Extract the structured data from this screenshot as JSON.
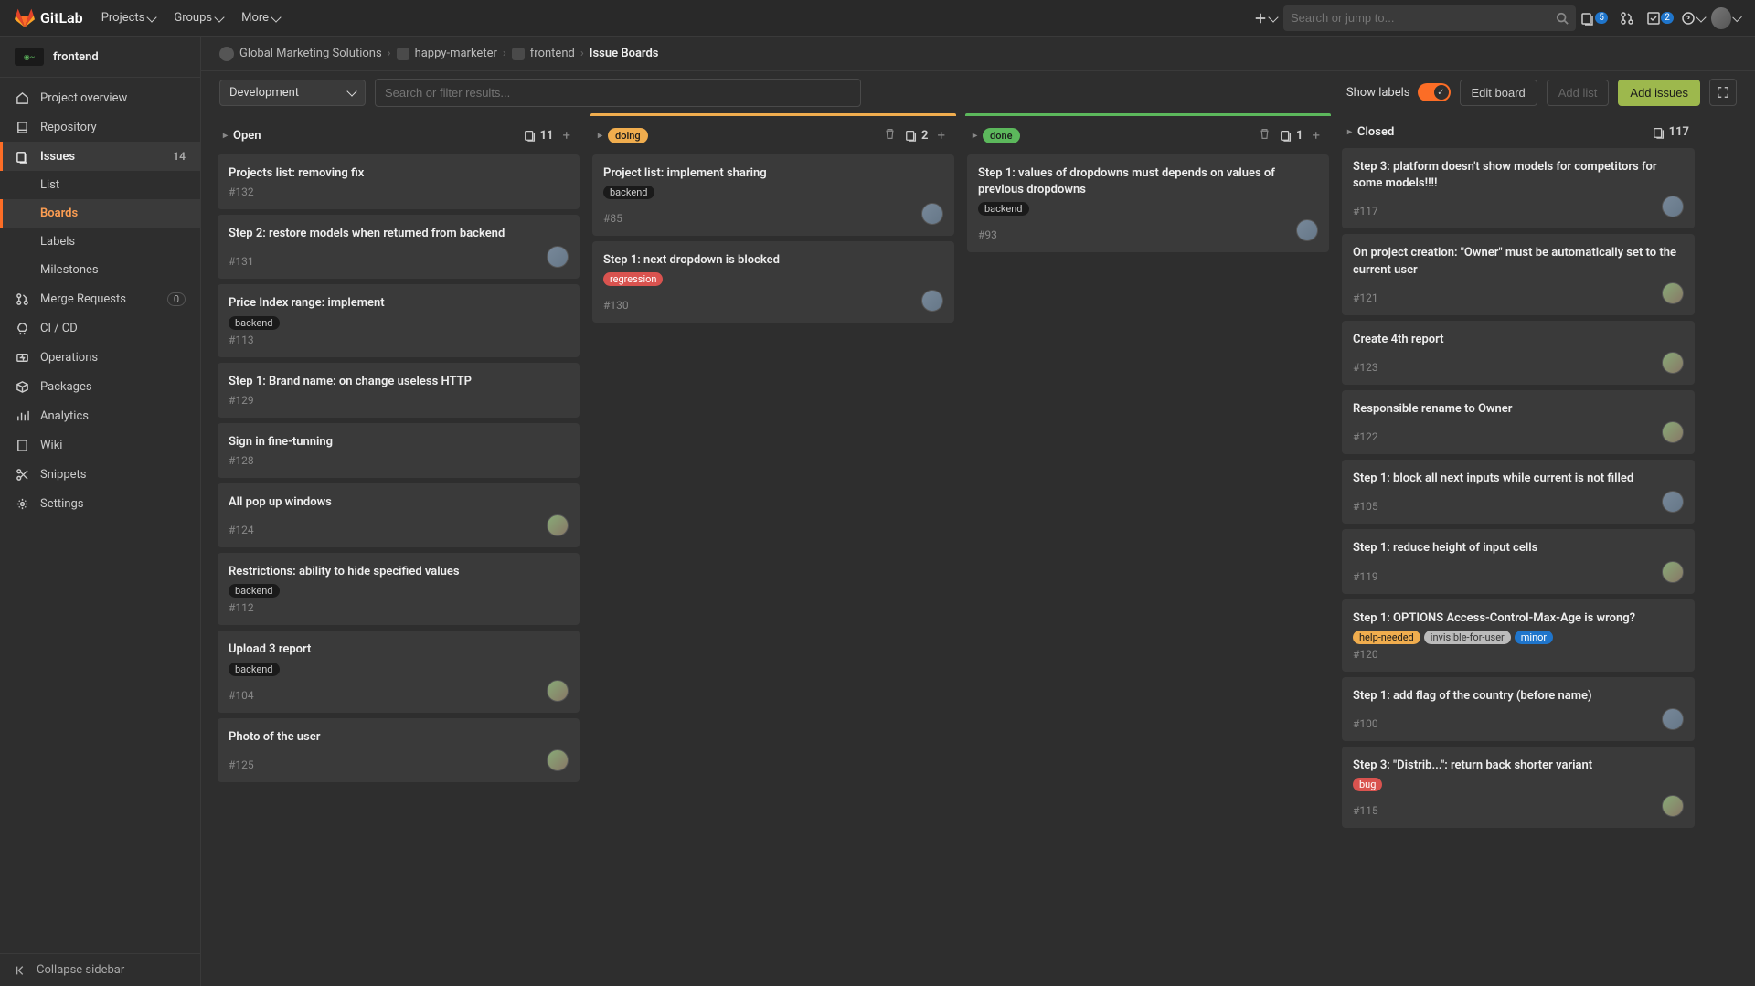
{
  "header": {
    "brand": "GitLab",
    "nav": {
      "projects": "Projects",
      "groups": "Groups",
      "more": "More"
    },
    "search_placeholder": "Search or jump to...",
    "issues_badge": "5",
    "todos_badge": "2"
  },
  "sidebar": {
    "project": "frontend",
    "items": {
      "overview": "Project overview",
      "repository": "Repository",
      "issues": "Issues",
      "issues_count": "14",
      "list": "List",
      "boards": "Boards",
      "labels": "Labels",
      "milestones": "Milestones",
      "merge_requests": "Merge Requests",
      "mr_count": "0",
      "cicd": "CI / CD",
      "operations": "Operations",
      "packages": "Packages",
      "analytics": "Analytics",
      "wiki": "Wiki",
      "snippets": "Snippets",
      "settings": "Settings"
    },
    "collapse": "Collapse sidebar"
  },
  "breadcrumbs": {
    "group": "Global Marketing Solutions",
    "subgroup": "happy-marketer",
    "project": "frontend",
    "page": "Issue Boards"
  },
  "toolbar": {
    "board_name": "Development",
    "filter_placeholder": "Search or filter results...",
    "show_labels": "Show labels",
    "edit_board": "Edit board",
    "add_list": "Add list",
    "add_issues": "Add issues"
  },
  "columns": [
    {
      "key": "open",
      "title": "Open",
      "count": "11",
      "accent": null,
      "label_bg": null,
      "delete": false,
      "cards": [
        {
          "title": "Projects list: removing fix",
          "id": "#132",
          "labels": [],
          "assignee": null
        },
        {
          "title": "Step 2: restore models when returned from backend",
          "id": "#131",
          "labels": [],
          "assignee": "alt"
        },
        {
          "title": "Price Index range: implement",
          "id": "#113",
          "labels": [
            {
              "text": "backend",
              "bg": "#1a1a1a",
              "fg": "#ccc"
            }
          ],
          "assignee": null
        },
        {
          "title": "Step 1: Brand name: on change useless HTTP",
          "id": "#129",
          "labels": [],
          "assignee": null
        },
        {
          "title": "Sign in fine-tunning",
          "id": "#128",
          "labels": [],
          "assignee": null
        },
        {
          "title": "All pop up windows",
          "id": "#124",
          "labels": [],
          "assignee": "a"
        },
        {
          "title": "Restrictions: ability to hide specified values",
          "id": "#112",
          "labels": [
            {
              "text": "backend",
              "bg": "#1a1a1a",
              "fg": "#ccc"
            }
          ],
          "assignee": null
        },
        {
          "title": "Upload 3 report",
          "id": "#104",
          "labels": [
            {
              "text": "backend",
              "bg": "#1a1a1a",
              "fg": "#ccc"
            }
          ],
          "assignee": "a"
        },
        {
          "title": "Photo of the user",
          "id": "#125",
          "labels": [],
          "assignee": "a"
        }
      ]
    },
    {
      "key": "doing",
      "title": "doing",
      "count": "2",
      "accent": "#f0ad4e",
      "label_bg": "#f0ad4e",
      "delete": true,
      "cards": [
        {
          "title": "Project list: implement sharing",
          "id": "#85",
          "labels": [
            {
              "text": "backend",
              "bg": "#1a1a1a",
              "fg": "#ccc"
            }
          ],
          "assignee": "alt"
        },
        {
          "title": "Step 1: next dropdown is blocked",
          "id": "#130",
          "labels": [
            {
              "text": "regression",
              "bg": "#d9534f",
              "fg": "#fff"
            }
          ],
          "assignee": "alt"
        }
      ]
    },
    {
      "key": "done",
      "title": "done",
      "count": "1",
      "accent": "#5cb85c",
      "label_bg": "#5cb85c",
      "delete": true,
      "cards": [
        {
          "title": "Step 1: values of dropdowns must depends on values of previous dropdowns",
          "id": "#93",
          "labels": [
            {
              "text": "backend",
              "bg": "#1a1a1a",
              "fg": "#ccc"
            }
          ],
          "assignee": "alt"
        }
      ]
    },
    {
      "key": "closed",
      "title": "Closed",
      "count": "117",
      "accent": null,
      "label_bg": null,
      "delete": false,
      "no_add": true,
      "cards": [
        {
          "title": "Step 3: platform doesn't show models for competitors for some models!!!!",
          "id": "#117",
          "labels": [],
          "assignee": "alt"
        },
        {
          "title": "On project creation: \"Owner\" must be automatically set to the current user",
          "id": "#121",
          "labels": [],
          "assignee": "a"
        },
        {
          "title": "Create 4th report",
          "id": "#123",
          "labels": [],
          "assignee": "a"
        },
        {
          "title": "Responsible rename to Owner",
          "id": "#122",
          "labels": [],
          "assignee": "a"
        },
        {
          "title": "Step 1: block all next inputs while current is not filled",
          "id": "#105",
          "labels": [],
          "assignee": "alt"
        },
        {
          "title": "Step 1: reduce height of input cells",
          "id": "#119",
          "labels": [],
          "assignee": "a"
        },
        {
          "title": "Step 1: OPTIONS Access-Control-Max-Age is wrong?",
          "id": "#120",
          "labels": [
            {
              "text": "help-needed",
              "bg": "#f0ad4e",
              "fg": "#1a1a1a"
            },
            {
              "text": "invisible-for-user",
              "bg": "#bbb",
              "fg": "#333"
            },
            {
              "text": "minor",
              "bg": "#1f75cb",
              "fg": "#fff"
            }
          ],
          "assignee": null
        },
        {
          "title": "Step 1: add flag of the country (before name)",
          "id": "#100",
          "labels": [],
          "assignee": "alt"
        },
        {
          "title": "Step 3: \"Distrib...\": return back shorter variant",
          "id": "#115",
          "labels": [
            {
              "text": "bug",
              "bg": "#d9534f",
              "fg": "#fff"
            }
          ],
          "assignee": "a"
        }
      ]
    }
  ]
}
